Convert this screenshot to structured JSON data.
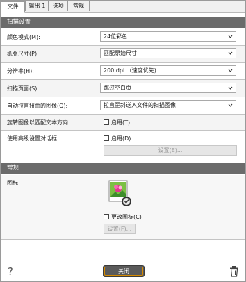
{
  "tabs": [
    {
      "label": "文件",
      "active": true
    },
    {
      "label": "输出 1",
      "active": false
    },
    {
      "label": "选项",
      "active": false
    },
    {
      "label": "常规",
      "active": false
    }
  ],
  "scan_section": {
    "title": "扫描设置",
    "color_mode": {
      "label": "颜色模式(M):",
      "value": "24位彩色"
    },
    "paper_size": {
      "label": "纸张尺寸(P):",
      "value": "匹配原始尺寸"
    },
    "resolution": {
      "label": "分辨率(H):",
      "value": "200 dpi （速度优先)"
    },
    "scan_pages": {
      "label": "扫描页面(S):",
      "value": "跳过空白页"
    },
    "auto_deskew": {
      "label": "自动拉直扭曲的图像(Q):",
      "value": "拉直歪斜送入文件的扫描图像"
    },
    "rotate": {
      "label": "旋转图像以匹配文本方向",
      "checkbox_label": "启用(T)",
      "checked": false
    },
    "advanced": {
      "label": "使用高级设置对话框",
      "checkbox_label": "启用(D)",
      "checked": false,
      "settings_button": "设置(E)..."
    }
  },
  "general_section": {
    "title": "常规",
    "icon_label": "图标",
    "change_icon": {
      "label": "更改图标(C)",
      "checked": false
    },
    "settings_button": "设置(F)..."
  },
  "footer": {
    "help_icon": "?",
    "close_button": "关闭",
    "delete_icon": "trash-icon"
  },
  "colors": {
    "section_header": "#6b6b6b",
    "close_button": "#5a5a5a",
    "close_focus": "#d68a00"
  }
}
